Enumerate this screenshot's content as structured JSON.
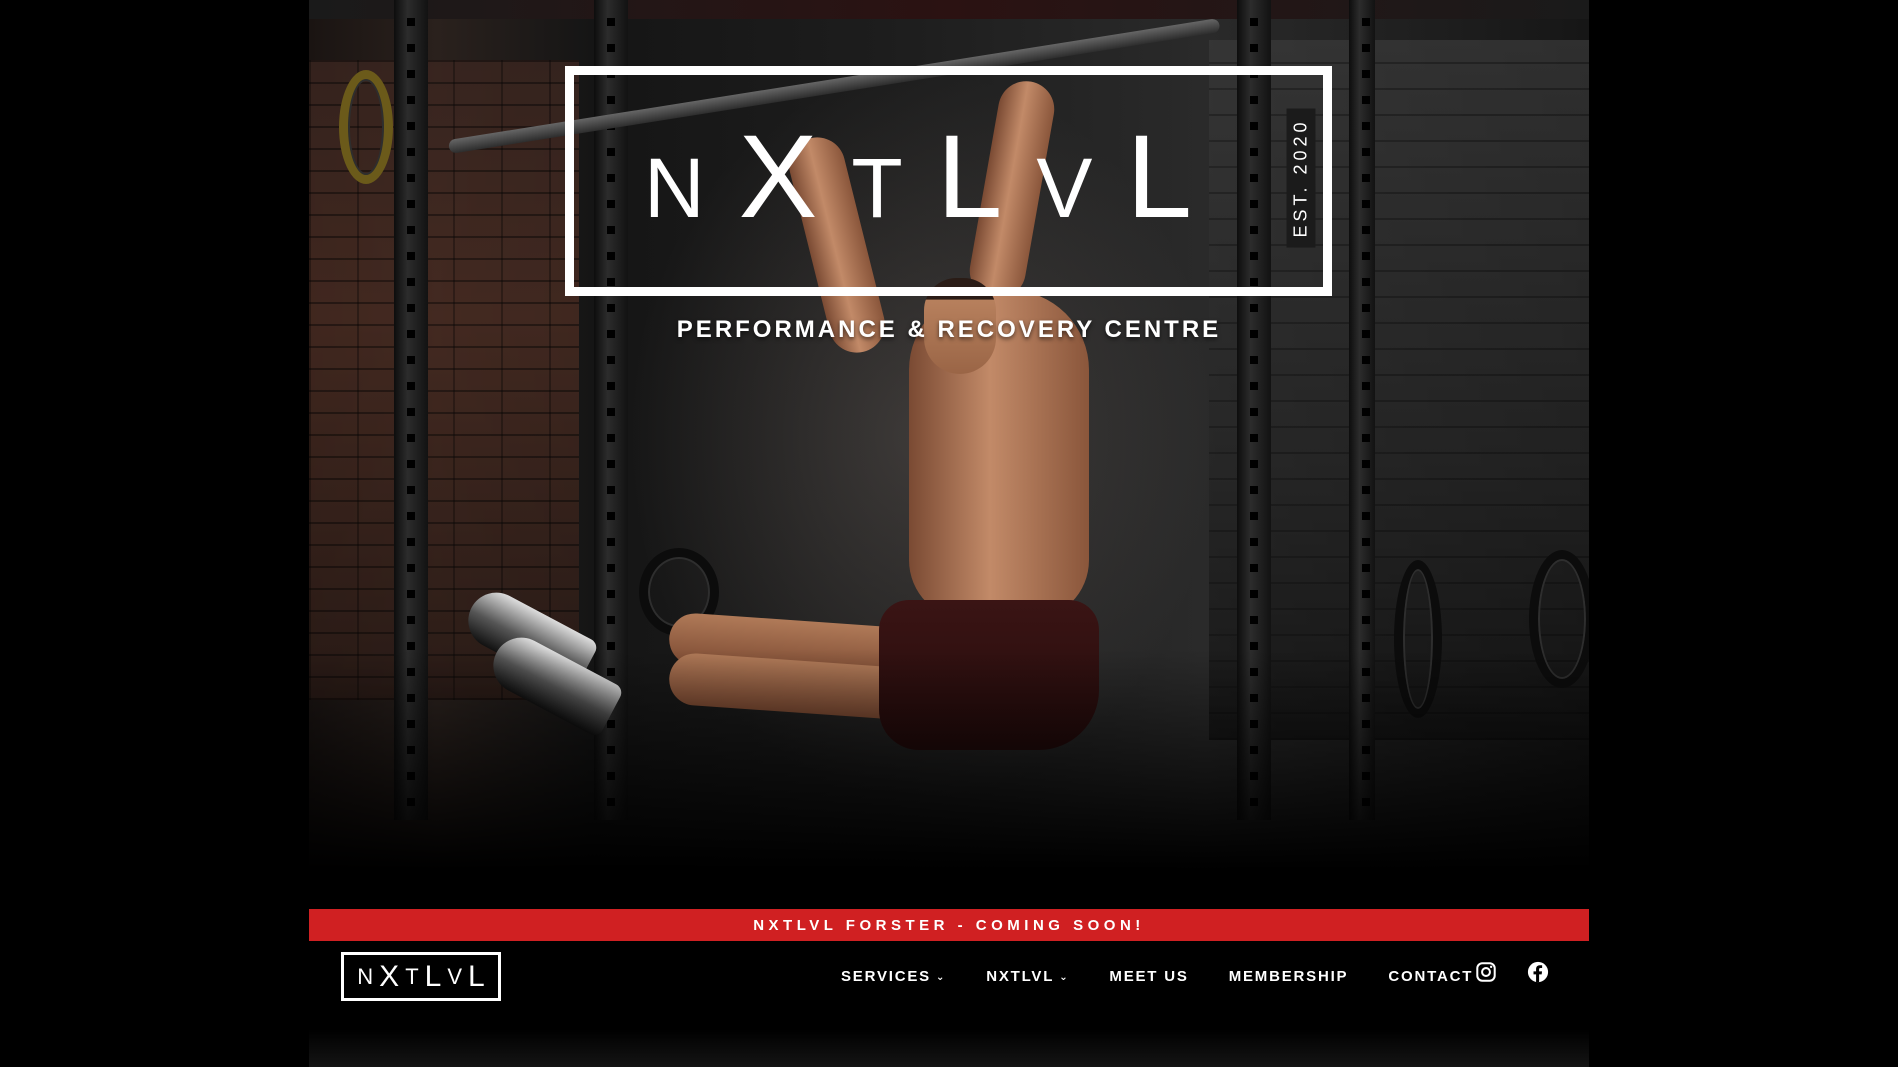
{
  "hero": {
    "logo_wordmark": "NXTLVL",
    "logo_letters": [
      "N",
      "X",
      "T",
      "L",
      "V",
      "L"
    ],
    "established": "EST. 2020",
    "tagline": "PERFORMANCE & RECOVERY CENTRE"
  },
  "banner": {
    "text": "NXTLVL FORSTER - COMING SOON!",
    "color": "#d02022"
  },
  "header": {
    "logo_letters": [
      "N",
      "X",
      "T",
      "L",
      "V",
      "L"
    ],
    "nav": [
      {
        "label": "SERVICES",
        "has_dropdown": true
      },
      {
        "label": "NXTLVL",
        "has_dropdown": true
      },
      {
        "label": "MEET US",
        "has_dropdown": false
      },
      {
        "label": "MEMBERSHIP",
        "has_dropdown": false
      },
      {
        "label": "CONTACT",
        "has_dropdown": false
      }
    ],
    "social": [
      {
        "icon": "instagram-icon"
      },
      {
        "icon": "facebook-icon"
      }
    ]
  },
  "colors": {
    "accent": "#d02022",
    "background": "#000000",
    "text": "#ffffff"
  }
}
